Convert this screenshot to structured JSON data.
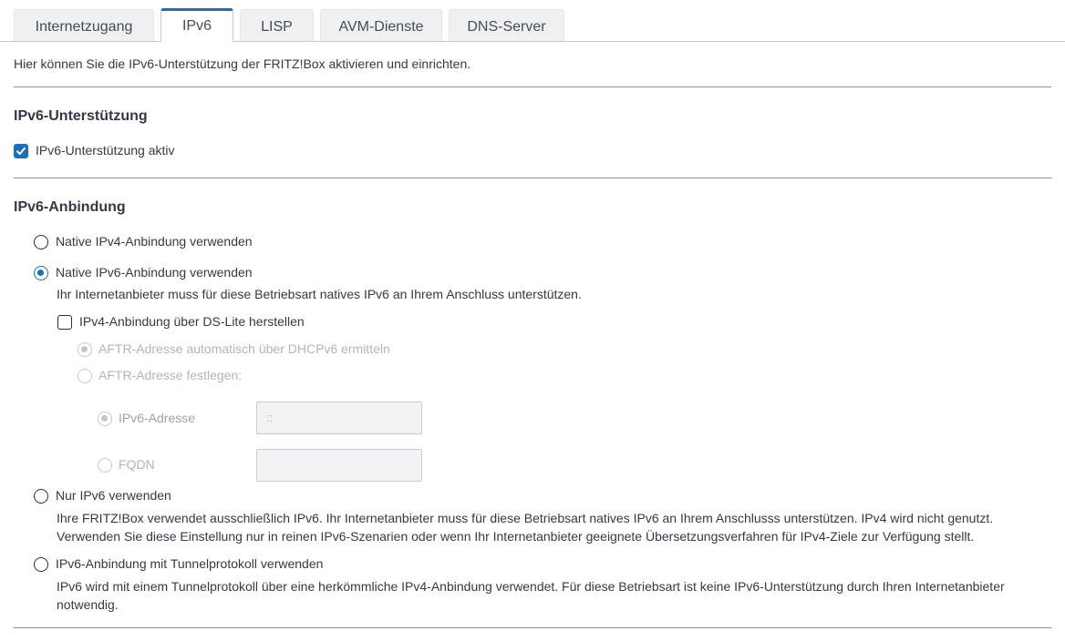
{
  "tabs": [
    {
      "label": "Internetzugang",
      "active": false
    },
    {
      "label": "IPv6",
      "active": true
    },
    {
      "label": "LISP",
      "active": false
    },
    {
      "label": "AVM-Dienste",
      "active": false
    },
    {
      "label": "DNS-Server",
      "active": false
    }
  ],
  "intro": "Hier können Sie die IPv6-Unterstützung der FRITZ!Box aktivieren und einrichten.",
  "support": {
    "heading": "IPv6-Unterstützung",
    "checkbox_label": "IPv6-Unterstützung aktiv",
    "checked": true
  },
  "connection": {
    "heading": "IPv6-Anbindung",
    "native_ipv4": {
      "label": "Native IPv4-Anbindung verwenden",
      "selected": false
    },
    "native_ipv6": {
      "label": "Native IPv6-Anbindung verwenden",
      "selected": true,
      "desc": "Ihr Internetanbieter muss für diese Betriebsart natives IPv6 an Ihrem Anschluss unterstützen.",
      "dslite": {
        "label": "IPv4-Anbindung über DS-Lite herstellen",
        "checked": false,
        "aftr_auto": "AFTR-Adresse automatisch über DHCPv6 ermitteln",
        "aftr_manual": "AFTR-Adresse festlegen:",
        "ipv6_label": "IPv6-Adresse",
        "ipv6_value": "::",
        "fqdn_label": "FQDN",
        "fqdn_value": ""
      }
    },
    "ipv6_only": {
      "label": "Nur IPv6 verwenden",
      "selected": false,
      "desc": "Ihre FRITZ!Box verwendet ausschließlich IPv6. Ihr Internetanbieter muss für diese Betriebsart natives IPv6 an Ihrem Anschlusss unterstützen. IPv4 wird nicht genutzt. Verwenden Sie diese Einstellung nur in reinen IPv6-Szenarien oder wenn Ihr Internetanbieter geeignete Übersetzungsverfahren für IPv4-Ziele zur Verfügung stellt."
    },
    "tunnel": {
      "label": "IPv6-Anbindung mit Tunnelprotokoll verwenden",
      "selected": false,
      "desc": "IPv6 wird mit einem Tunnelprotokoll über eine herkömmliche IPv4-Anbindung verwendet. Für diese Betriebsart ist keine IPv6-Unterstützung durch Ihren Internetanbieter notwendig."
    }
  },
  "colors": {
    "accent": "#1b6fb8",
    "text": "#333a44",
    "disabled": "#b1b5ba"
  }
}
